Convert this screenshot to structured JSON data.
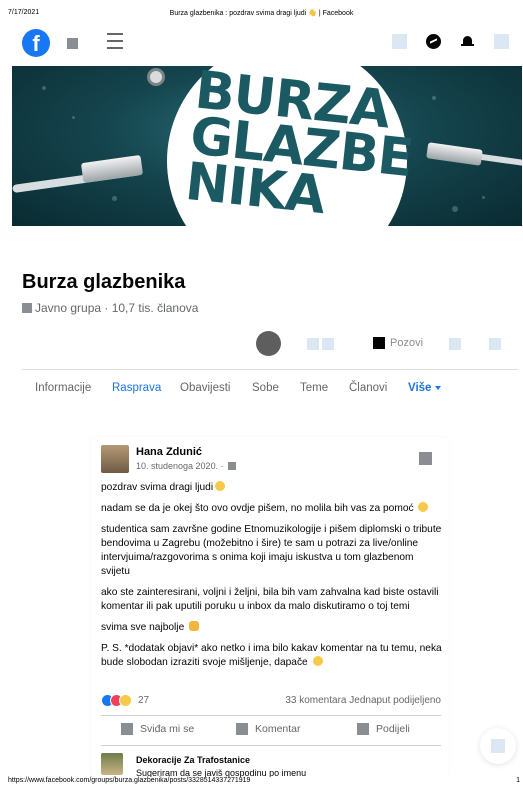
{
  "print": {
    "date": "7/17/2021",
    "title": "Burza glazbenika : pozdrav svima dragi ljudi 👋 | Facebook",
    "url": "https://www.facebook.com/groups/burza.glazbenika/posts/3328514337271919",
    "page": "1"
  },
  "topbar": {
    "logo": "f"
  },
  "cover": {
    "logo_text": "BURZA GLAZBE NIKA"
  },
  "group": {
    "name": "Burza glazbenika",
    "meta": "Javno grupa · 10,7 tis. članova",
    "invite_label": "Pozovi"
  },
  "tabs": [
    {
      "label": "Informacije"
    },
    {
      "label": "Rasprava"
    },
    {
      "label": "Obavijesti"
    },
    {
      "label": "Sobe"
    },
    {
      "label": "Teme"
    },
    {
      "label": "Članovi"
    },
    {
      "label": "Više"
    }
  ],
  "post": {
    "author": "Hana Zdunić",
    "date": "10. studenoga 2020. ·",
    "paragraphs": [
      "pozdrav svima dragi ljudi",
      "nadam se da je okej što ovo ovdje pišem, no molila bih vas za pomoć",
      "studentica sam završne godine Etnomuzikologije i pišem diplomski o tribute bendovima u Zagrebu (možebitno i šire) te sam u potrazi za live/online intervjuima/razgovorima s onima koji imaju iskustva u tom glazbenom svijetu",
      "ako ste zainteresirani, voljni i željni, bila bih vam zahvalna kad biste ostavili komentar ili pak uputili poruku u inbox da malo diskutiramo o toj temi",
      "svima sve najbolje",
      "P. S. *dodatak objavi* ako netko i ima bilo kakav komentar na tu temu, neka bude slobodan izraziti svoje mišljenje, dapače"
    ],
    "reaction_count": "27",
    "comments_shares": "33 komentara  Jednaput podijeljeno",
    "like_label": "Sviđa mi se",
    "comment_label": "Komentar",
    "share_label": "Podijeli"
  },
  "comment": {
    "author": "Dekoracije Za Trafostanice",
    "text": "Sugeriram da se javiš gospodinu po imenu"
  },
  "colors": {
    "accent": "#1b74e4",
    "facebook_blue": "#1877f2",
    "muted": "#65676b"
  }
}
